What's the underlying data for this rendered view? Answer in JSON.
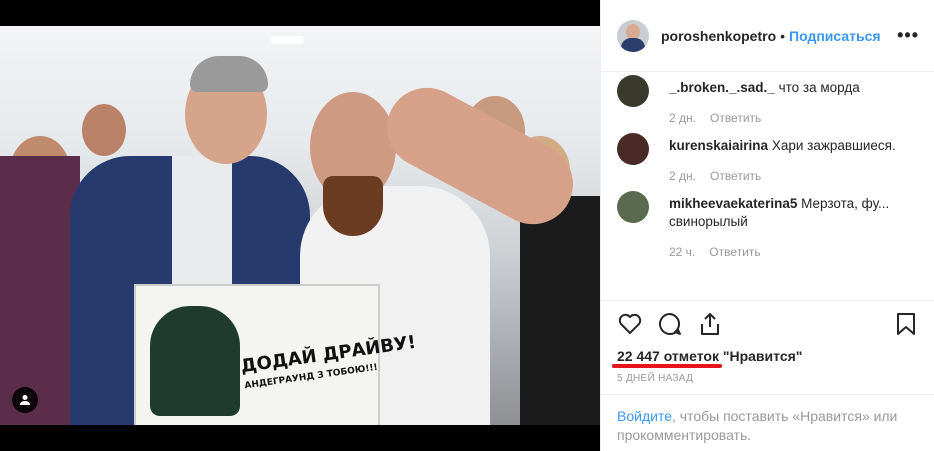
{
  "post": {
    "username": "poroshenkopetro",
    "separator": "•",
    "follow_label": "Подписаться",
    "more_label": "•••",
    "poster": {
      "title": "ДОДАЙ ДРАЙВУ!",
      "subtitle": "АНДЕГРАУНД З ТОБОЮ!!!"
    }
  },
  "comments": [
    {
      "username": "_.broken._.sad._",
      "text": "что за морда",
      "time": "2 дн.",
      "reply_label": "Ответить"
    },
    {
      "username": "kurenskaiairina",
      "text": "Хари зажравшиеся.",
      "time": "2 дн.",
      "reply_label": "Ответить"
    },
    {
      "username": "mikheevaekaterina5",
      "text": "Мерзота, фу... свинорылый",
      "time": "22 ч.",
      "reply_label": "Ответить"
    }
  ],
  "stats": {
    "likes_text": "22 447 отметок \"Нравится\"",
    "date_text": "5 ДНЕЙ НАЗАД"
  },
  "login": {
    "link_text": "Войдите",
    "rest_text": ", чтобы поставить «Нравится» или прокомментировать."
  },
  "colors": {
    "accent": "#3897f0",
    "annotation_red": "#e8131b"
  },
  "icons": [
    "heart-icon",
    "comment-icon",
    "share-icon",
    "bookmark-icon",
    "user-tag-icon",
    "more-icon"
  ]
}
